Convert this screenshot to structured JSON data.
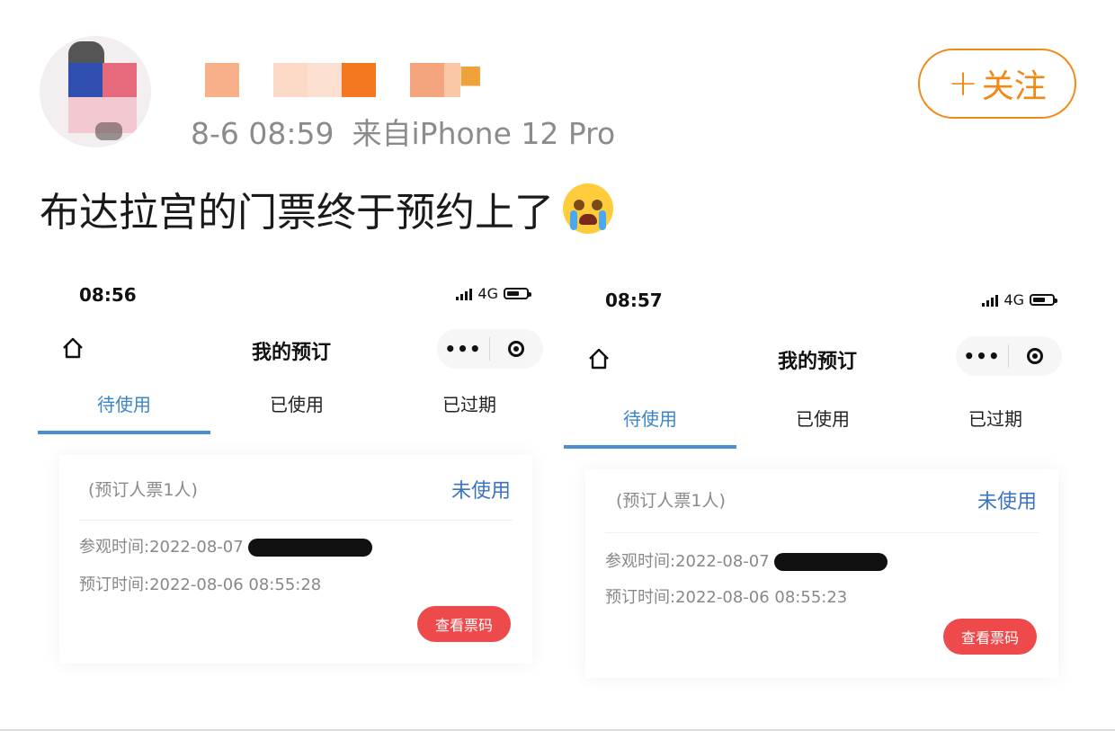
{
  "post": {
    "time": "8-6 08:59",
    "source": "来自iPhone 12 Pro",
    "follow_label": "关注",
    "text": "布达拉宫的门票终于预约上了",
    "emoji_icon": "crying-face-emoji"
  },
  "colors": {
    "accent_orange": "#f08a16",
    "tab_blue": "#3a86c8",
    "status_blue": "#3b73c4",
    "button_red": "#ee4a4c"
  },
  "screenshots": [
    {
      "status_time": "08:56",
      "network": "4G",
      "nav_title": "我的预订",
      "capsule_more": "•••",
      "tabs": [
        {
          "label": "待使用"
        },
        {
          "label": "已使用"
        },
        {
          "label": "已过期"
        }
      ],
      "card": {
        "who": "(预订人票1人)",
        "state": "未使用",
        "visit_time": "参观时间:2022-08-07",
        "booking_time": "预订时间:2022-08-06 08:55:28",
        "button": "查看票码"
      }
    },
    {
      "status_time": "08:57",
      "network": "4G",
      "nav_title": "我的预订",
      "capsule_more": "•••",
      "tabs": [
        {
          "label": "待使用"
        },
        {
          "label": "已使用"
        },
        {
          "label": "已过期"
        }
      ],
      "card": {
        "who": "(预订人票1人)",
        "state": "未使用",
        "visit_time": "参观时间:2022-08-07",
        "booking_time": "预订时间:2022-08-06 08:55:23",
        "button": "查看票码"
      }
    }
  ]
}
